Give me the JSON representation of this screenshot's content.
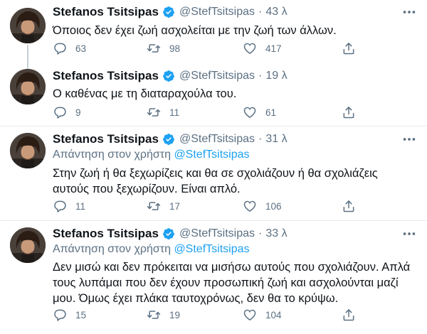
{
  "tweets": [
    {
      "name": "Stefanos Tsitsipas",
      "handle": "@StefTsitsipas",
      "separator": "·",
      "time": "43 λ",
      "reply_prefix": "",
      "reply_mention": "",
      "text": "Όποιος δεν έχει ζωή ασχολείται με την ζωή των άλλων.",
      "replies": "63",
      "retweets": "98",
      "likes": "417"
    },
    {
      "name": "Stefanos Tsitsipas",
      "handle": "@StefTsitsipas",
      "separator": "·",
      "time": "19 λ",
      "reply_prefix": "",
      "reply_mention": "",
      "text": "Ο καθένας με τη διαταραχούλα του.",
      "replies": "9",
      "retweets": "11",
      "likes": "61"
    },
    {
      "name": "Stefanos Tsitsipas",
      "handle": "@StefTsitsipas",
      "separator": "·",
      "time": "31 λ",
      "reply_prefix": "Απάντηση στον χρήστη",
      "reply_mention": "@StefTsitsipas",
      "text": "Στην ζωή ή θα ξεχωρίζεις και θα σε σχολιάζουν ή θα σχολιάζεις αυτούς που ξεχωρίζουν. Είναι απλό.",
      "replies": "11",
      "retweets": "17",
      "likes": "106"
    },
    {
      "name": "Stefanos Tsitsipas",
      "handle": "@StefTsitsipas",
      "separator": "·",
      "time": "33 λ",
      "reply_prefix": "Απάντηση στον χρήστη",
      "reply_mention": "@StefTsitsipas",
      "text": "Δεν μισώ και δεν πρόκειται να μισήσω αυτούς που σχολιάζουν. Απλά τους λυπάμαι που δεν έχουν προσωπική ζωή και ασχολούνται μαζί μου. Όμως έχει πλάκα ταυτοχρόνως, δεν θα το κρύψω.",
      "replies": "15",
      "retweets": "19",
      "likes": "104"
    }
  ],
  "colors": {
    "text": "#0f1419",
    "secondary": "#5b7083",
    "accent": "#1da1f2",
    "divider": "#e6ecf0",
    "thread_line": "#c4cfd6"
  },
  "icons": [
    "verified-badge-icon",
    "more-options-icon",
    "reply-icon",
    "retweet-icon",
    "like-icon",
    "share-icon"
  ]
}
